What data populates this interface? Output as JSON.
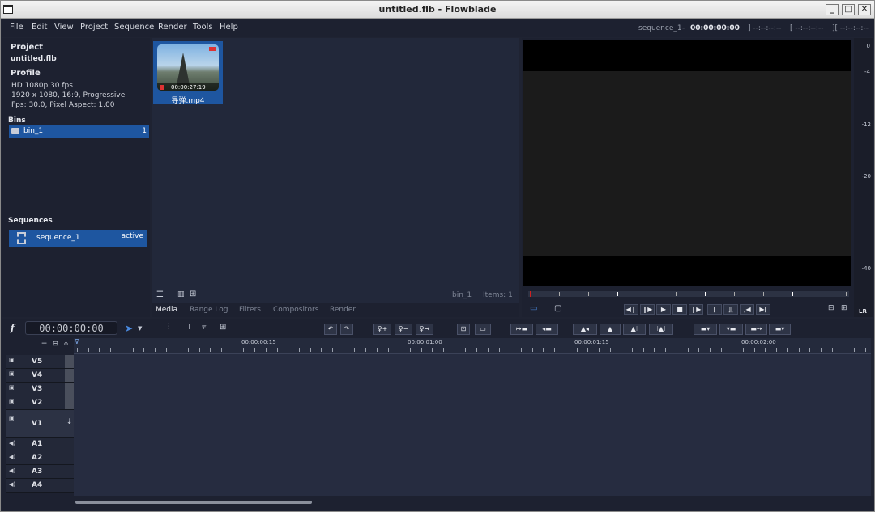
{
  "window": {
    "title": "untitled.flb - Flowblade"
  },
  "menu": [
    "File",
    "Edit",
    "View",
    "Project",
    "Sequence",
    "Render",
    "Tools",
    "Help"
  ],
  "sequence_info": {
    "name": "sequence_1",
    "separator": " - ",
    "timecode": "00:00:00:00",
    "mark_in": "] --:--:--:--",
    "mark_out": "[ --:--:--:--",
    "length": "][ --:--:--:--"
  },
  "project": {
    "heading": "Project",
    "name": "untitled.flb",
    "profile_heading": "Profile",
    "profile_lines": [
      "HD 1080p 30 fps",
      "1920 x 1080, 16:9, Progressive",
      "Fps: 30.0, Pixel Aspect: 1.00"
    ]
  },
  "bins": {
    "heading": "Bins",
    "items": [
      {
        "name": "bin_1",
        "count": "1"
      }
    ]
  },
  "sequences": {
    "heading": "Sequences",
    "items": [
      {
        "name": "sequence_1",
        "status": "active"
      }
    ]
  },
  "media": {
    "items": [
      {
        "name": "导弹.mp4",
        "duration": "00:00:27:19"
      }
    ],
    "current_bin": "bin_1",
    "items_label": "Items: 1",
    "tabs": [
      "Media",
      "Range Log",
      "Filters",
      "Compositors",
      "Render"
    ],
    "active_tab": "Media"
  },
  "monitor": {
    "vu_labels": [
      "0",
      "-4",
      "-12",
      "-20",
      "-40"
    ],
    "vu_channels": "LR"
  },
  "timeline": {
    "timecode": "00:00:00:00",
    "ruler_labels": [
      "00:00:00:15",
      "00:00:01:00",
      "00:00:01:15",
      "00:00:02:00"
    ],
    "tracks": [
      "V5",
      "V4",
      "V3",
      "V2",
      "V1",
      "A1",
      "A2",
      "A3",
      "A4"
    ]
  },
  "colors": {
    "selection": "#1e56a0",
    "background": "#1f2332",
    "panel": "#22283a"
  }
}
